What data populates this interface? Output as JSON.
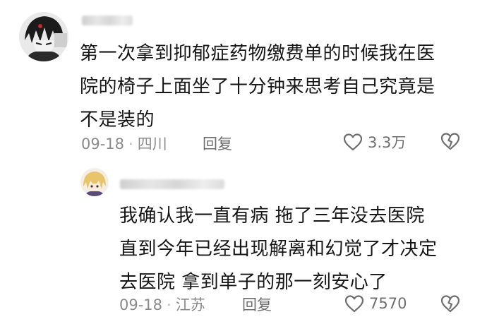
{
  "comments": [
    {
      "avatar_icon": "avatar-anime-character-dark-hair",
      "text_lines": [
        "第一次拿到抑郁症药物缴费单的时候我在医",
        "院的椅子上面坐了十分钟来思考自己究竟是",
        "不是装的"
      ],
      "date": "09-18",
      "location": "四川",
      "reply_label": "回复",
      "likes": "3.3万"
    },
    {
      "avatar_icon": "avatar-anime-character-blonde",
      "text_lines": [
        "我确认我一直有病 拖了三年没去医院",
        "直到今年已经出现解离和幻觉了才决定",
        "去医院 拿到单子的那一刻安心了"
      ],
      "date": "09-18",
      "location": "江苏",
      "reply_label": "回复",
      "likes": "7570"
    }
  ],
  "icons": {
    "like": "heart-outline-icon",
    "dislike": "broken-heart-icon"
  },
  "colors": {
    "text": "#161616",
    "meta": "#8a8a8a",
    "icon": "#6e6e6e"
  }
}
